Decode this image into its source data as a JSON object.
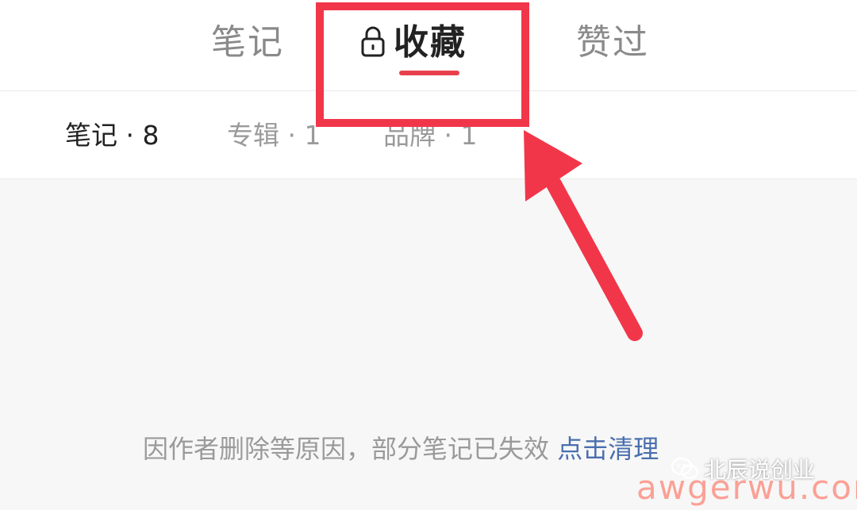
{
  "tabs": {
    "notes": "笔记",
    "collect": "收藏",
    "liked": "赞过"
  },
  "subtabs": {
    "notes": "笔记 · 8",
    "album": "专辑 · 1",
    "brand": "品牌 · 1"
  },
  "notice": {
    "text": "因作者删除等原因，部分笔记已失效 ",
    "link": "点击清理"
  },
  "watermark": {
    "brand": "北辰说创业",
    "site": "awgerwu.com"
  },
  "colors": {
    "accent": "#e8404b",
    "annotation": "#f2364a",
    "link": "#4a6fae"
  },
  "icons": {
    "collect_tab": "lock-icon"
  }
}
